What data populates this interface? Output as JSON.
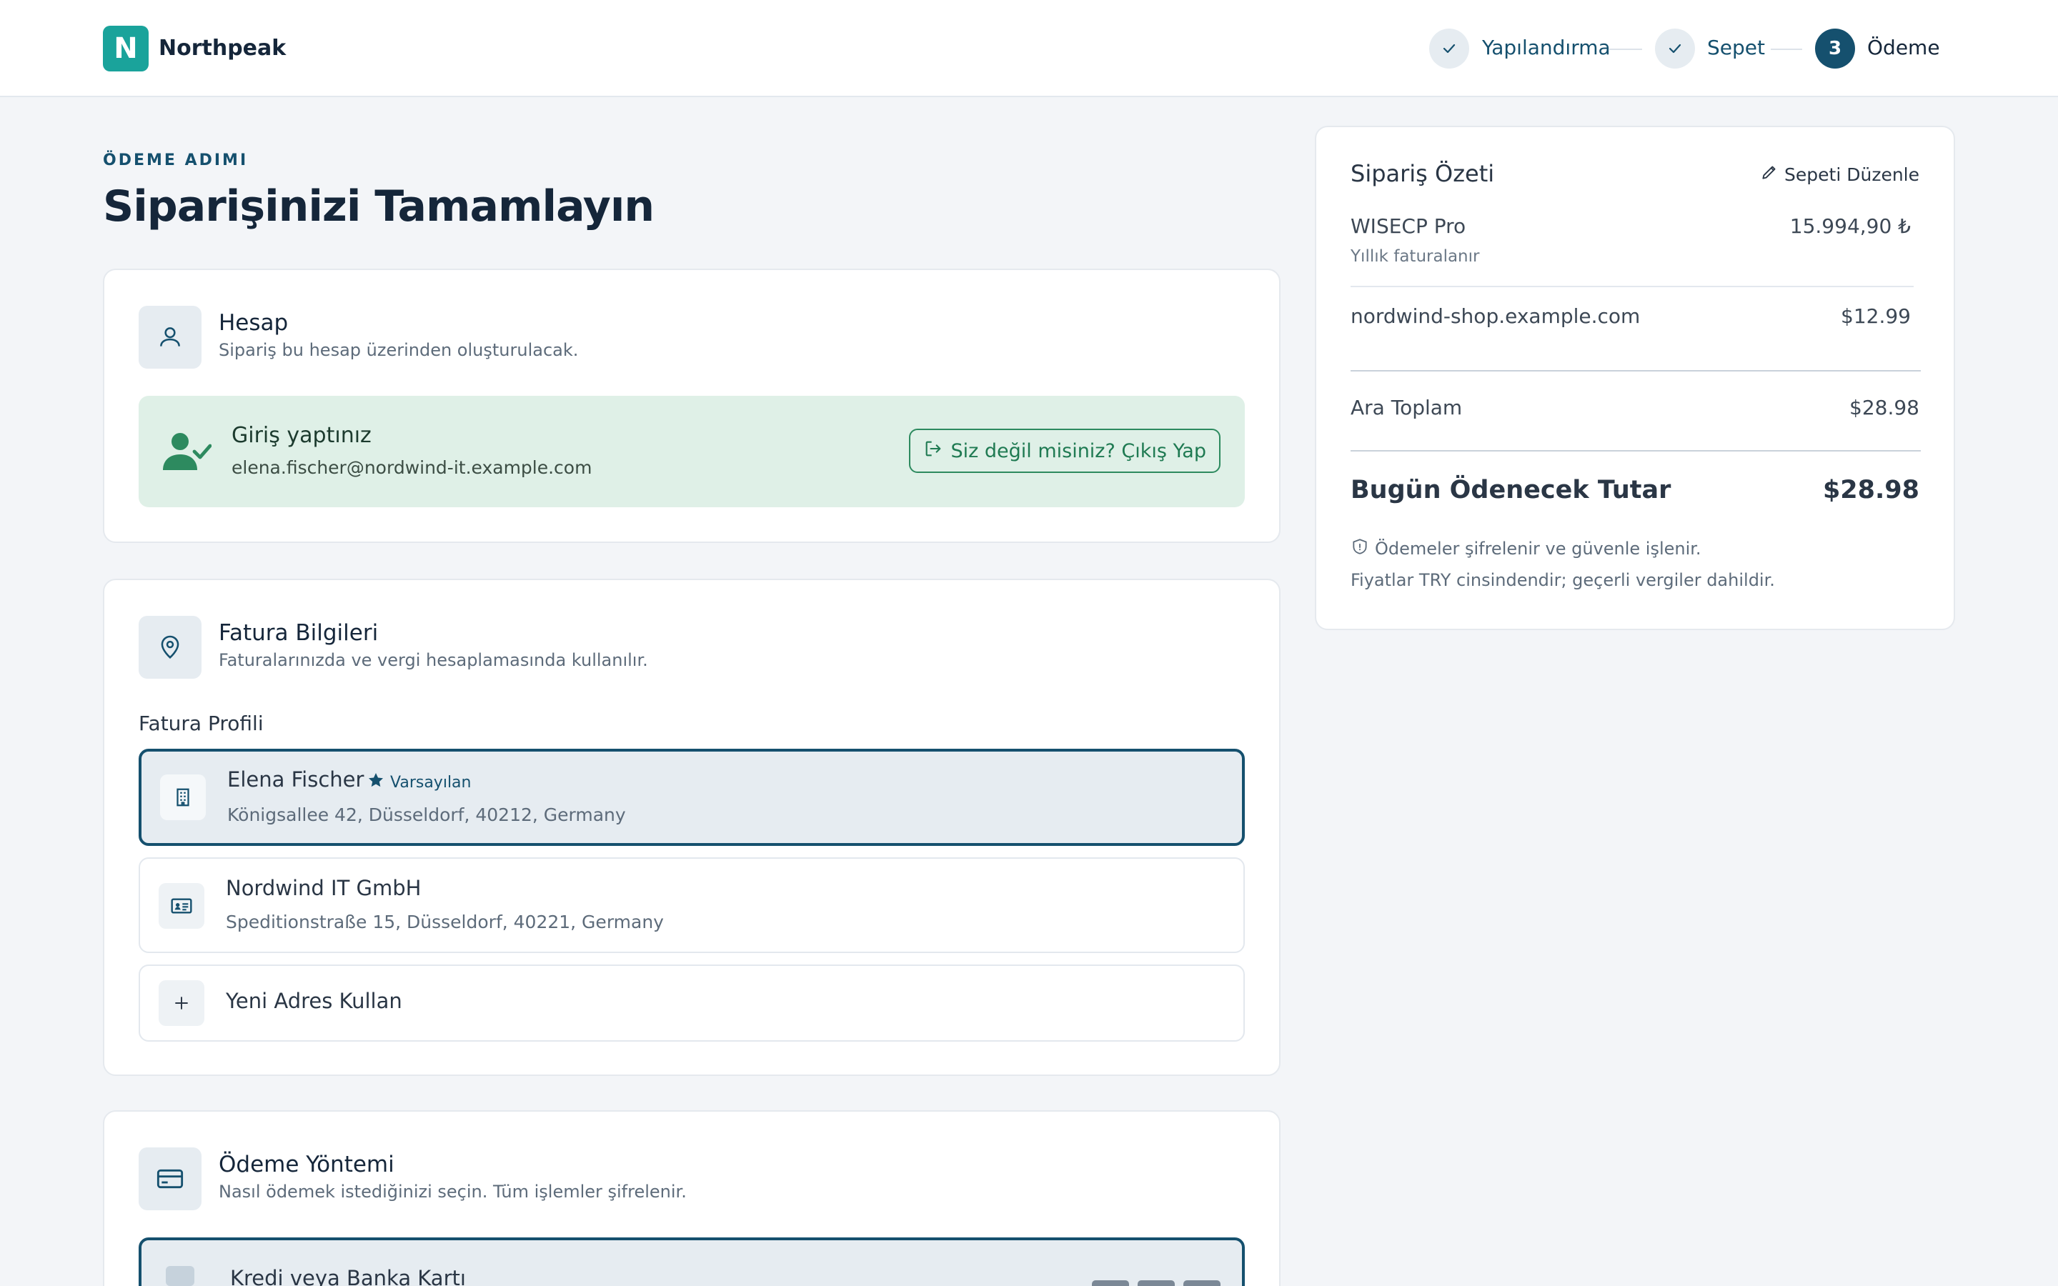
{
  "brand": {
    "logo_letter": "N",
    "name": "Northpeak",
    "accent": "#1aa39b"
  },
  "steps": [
    {
      "label": "Yapılandırma",
      "state": "done"
    },
    {
      "label": "Sepet",
      "state": "done"
    },
    {
      "label": "Ödeme",
      "state": "active",
      "number": "3"
    }
  ],
  "header": {
    "kicker": "ÖDEME ADIMI",
    "title": "Siparişinizi Tamamlayın"
  },
  "account": {
    "title": "Hesap",
    "subtitle": "Sipariş bu hesap üzerinden oluşturulacak.",
    "login_title": "Giriş yaptınız",
    "email": "elena.fischer@nordwind-it.example.com",
    "logout_label": "Siz değil misiniz? Çıkış Yap"
  },
  "billing": {
    "title": "Fatura Bilgileri",
    "subtitle": "Faturalarınızda ve vergi hesaplamasında kullanılır.",
    "profile_label": "Fatura Profili",
    "profiles": [
      {
        "name": "Elena Fischer",
        "badge": "Varsayılan",
        "address": "Königsallee 42, Düsseldorf, 40212, Germany",
        "icon": "building-icon",
        "selected": true
      },
      {
        "name": "Nordwind IT GmbH",
        "address": "Speditionstraße 15, Düsseldorf, 40221, Germany",
        "icon": "id-card-icon",
        "selected": false
      }
    ],
    "new_address_label": "Yeni Adres Kullan"
  },
  "payment": {
    "title": "Ödeme Yöntemi",
    "subtitle": "Nasıl ödemek istediğinizi seçin. Tüm işlemler şifrelenir.",
    "option_label": "Kredi veya Banka Kartı"
  },
  "summary": {
    "title": "Sipariş Özeti",
    "edit_label": "Sepeti Düzenle",
    "items": [
      {
        "name": "WISECP Pro",
        "sub": "Yıllık faturalanır",
        "price": "15.994,90 ₺"
      },
      {
        "name": "nordwind-shop.example.com",
        "price": "$12.99"
      }
    ],
    "subtotal_label": "Ara Toplam",
    "subtotal_value": "$28.98",
    "total_label": "Bugün Ödenecek Tutar",
    "total_value": "$28.98",
    "note_secure": "Ödemeler şifrelenir ve güvenle işlenir.",
    "note_currency": "Fiyatlar TRY cinsindendir; geçerli vergiler dahildir."
  },
  "colors": {
    "primary": "#15506e",
    "success_bg": "#dff0e7",
    "success": "#1f7a52"
  }
}
